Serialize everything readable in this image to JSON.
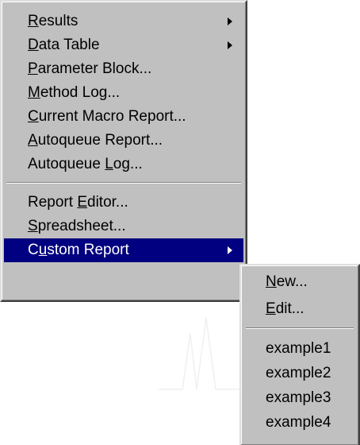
{
  "main_menu": {
    "items": [
      {
        "pre": "",
        "u": "R",
        "post": "esults",
        "submenu": true
      },
      {
        "pre": "",
        "u": "D",
        "post": "ata Table",
        "submenu": true
      },
      {
        "pre": "",
        "u": "P",
        "post": "arameter Block...",
        "submenu": false
      },
      {
        "pre": "",
        "u": "M",
        "post": "ethod Log...",
        "submenu": false
      },
      {
        "pre": "",
        "u": "C",
        "post": "urrent Macro Report...",
        "submenu": false
      },
      {
        "pre": "",
        "u": "A",
        "post": "utoqueue Report...",
        "submenu": false
      },
      {
        "pre": "Autoqueue ",
        "u": "L",
        "post": "og...",
        "submenu": false
      },
      {
        "pre": "Report ",
        "u": "E",
        "post": "ditor...",
        "submenu": false
      },
      {
        "pre": "",
        "u": "S",
        "post": "preadsheet...",
        "submenu": false
      },
      {
        "pre": "C",
        "u": "u",
        "post": "stom Report",
        "submenu": true,
        "selected": true
      }
    ]
  },
  "sub_menu": {
    "items": [
      {
        "pre": "",
        "u": "N",
        "post": "ew..."
      },
      {
        "pre": "",
        "u": "E",
        "post": "dit..."
      },
      {
        "label": "example1"
      },
      {
        "label": "example2"
      },
      {
        "label": "example3"
      },
      {
        "label": "example4"
      }
    ]
  },
  "colors": {
    "menu_bg": "#c0c0c0",
    "highlight": "#000080",
    "highlight_text": "#ffffff"
  },
  "icons": {
    "submenu_arrow": "submenu-arrow-icon"
  }
}
